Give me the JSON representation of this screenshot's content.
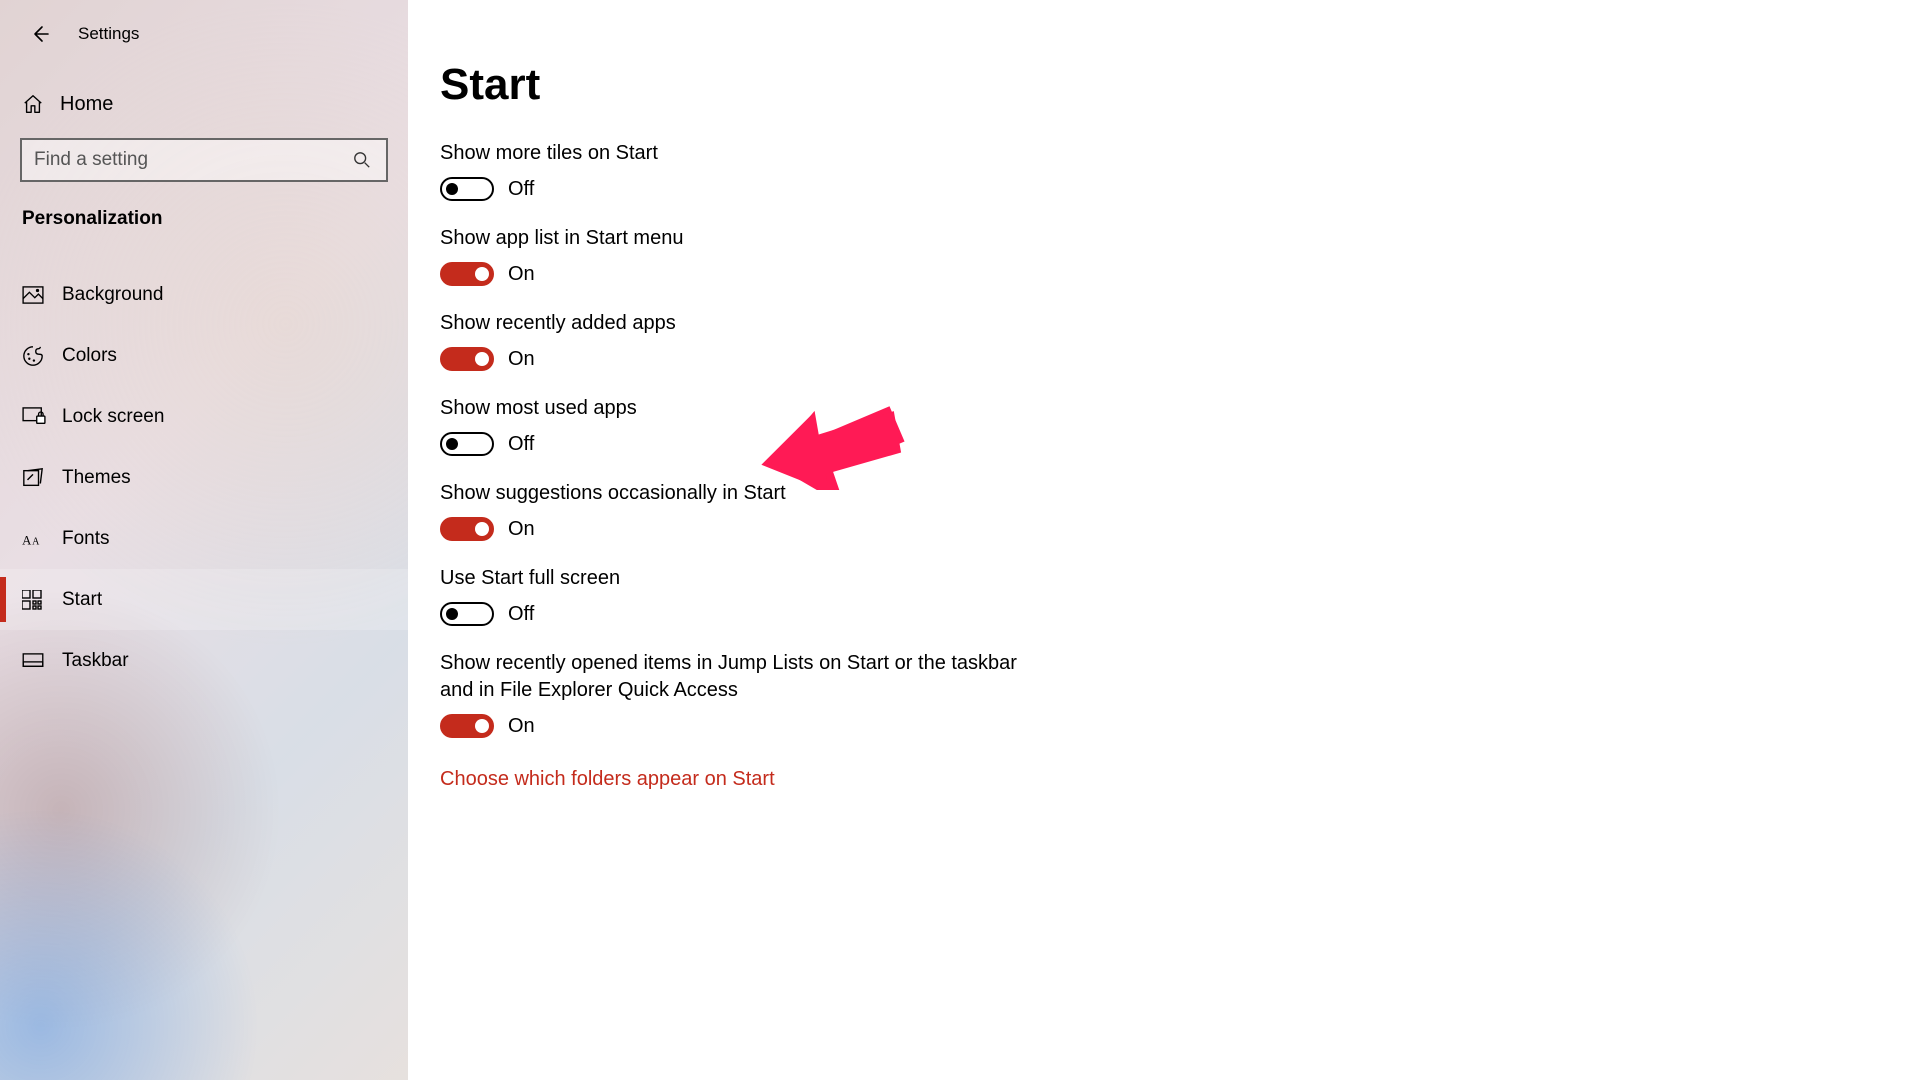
{
  "app": {
    "title": "Settings"
  },
  "sidebar": {
    "home_label": "Home",
    "search_placeholder": "Find a setting",
    "section_title": "Personalization",
    "items": [
      {
        "label": "Background",
        "icon": "picture-icon",
        "selected": false
      },
      {
        "label": "Colors",
        "icon": "palette-icon",
        "selected": false
      },
      {
        "label": "Lock screen",
        "icon": "lockscreen-icon",
        "selected": false
      },
      {
        "label": "Themes",
        "icon": "themes-icon",
        "selected": false
      },
      {
        "label": "Fonts",
        "icon": "fonts-icon",
        "selected": false
      },
      {
        "label": "Start",
        "icon": "start-icon",
        "selected": true
      },
      {
        "label": "Taskbar",
        "icon": "taskbar-icon",
        "selected": false
      }
    ]
  },
  "main": {
    "page_title": "Start",
    "settings": [
      {
        "label": "Show more tiles on Start",
        "on": false
      },
      {
        "label": "Show app list in Start menu",
        "on": true
      },
      {
        "label": "Show recently added apps",
        "on": true
      },
      {
        "label": "Show most used apps",
        "on": false
      },
      {
        "label": "Show suggestions occasionally in Start",
        "on": true
      },
      {
        "label": "Use Start full screen",
        "on": false
      },
      {
        "label": "Show recently opened items in Jump Lists on Start or the taskbar and in File Explorer Quick Access",
        "on": true
      }
    ],
    "state_labels": {
      "on": "On",
      "off": "Off"
    },
    "link": "Choose which folders appear on Start"
  },
  "colors": {
    "accent": "#c42b1c"
  },
  "annotation": {
    "arrow_color": "#ff1a55"
  }
}
